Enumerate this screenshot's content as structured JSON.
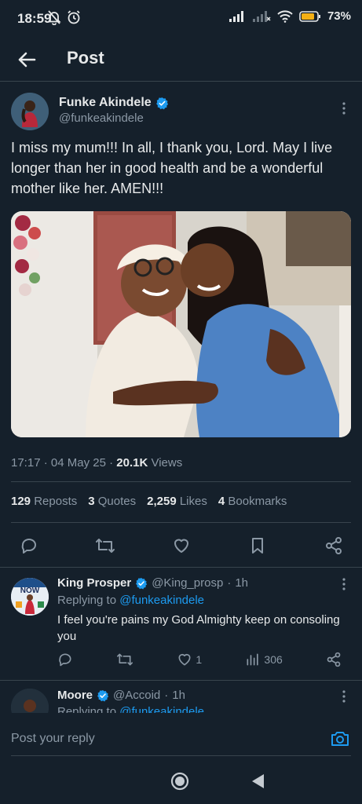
{
  "status_bar": {
    "time": "18:59",
    "battery_percent": "73",
    "battery_suffix": "%",
    "icons": [
      "mute-icon",
      "alarm-icon",
      "signal-icon",
      "signal-icon",
      "wifi-icon",
      "battery-icon"
    ]
  },
  "header": {
    "title": "Post",
    "back_icon": "arrow-left-icon"
  },
  "post": {
    "author_name": "Funke Akindele",
    "author_handle": "@funkeakindele",
    "verified": true,
    "text": "I miss my mum!!! In all, I thank you, Lord. May I live longer than her in good health and be a wonderful mother like her. AMEN!!!",
    "time": "17:17",
    "date": "04 May 25",
    "separator": "·",
    "views_count": "20.1K",
    "views_label": "Views",
    "reposts_count": "129",
    "reposts_label": "Reposts",
    "quotes_count": "3",
    "quotes_label": "Quotes",
    "likes_count": "2,259",
    "likes_label": "Likes",
    "bookmarks_count": "4",
    "bookmarks_label": "Bookmarks"
  },
  "replies": [
    {
      "name": "King Prosper",
      "handle": "@King_prosp",
      "time": "1h",
      "replying_to_label": "Replying to",
      "replying_to_handle": "@funkeakindele",
      "text": "I feel you're pains my God Almighty keep on consoling you",
      "avatar_text": "NOW",
      "likes": "1",
      "views": "306"
    },
    {
      "name": "Moore",
      "handle": "@Accoid",
      "time": "1h",
      "replying_to_label": "Replying to",
      "replying_to_handle": "@funkeakindele"
    }
  ],
  "composer": {
    "placeholder": "Post your reply"
  },
  "colors": {
    "background": "#15202b",
    "accent": "#1d9bf0",
    "muted": "#8b98a5",
    "divider": "#38444d"
  }
}
